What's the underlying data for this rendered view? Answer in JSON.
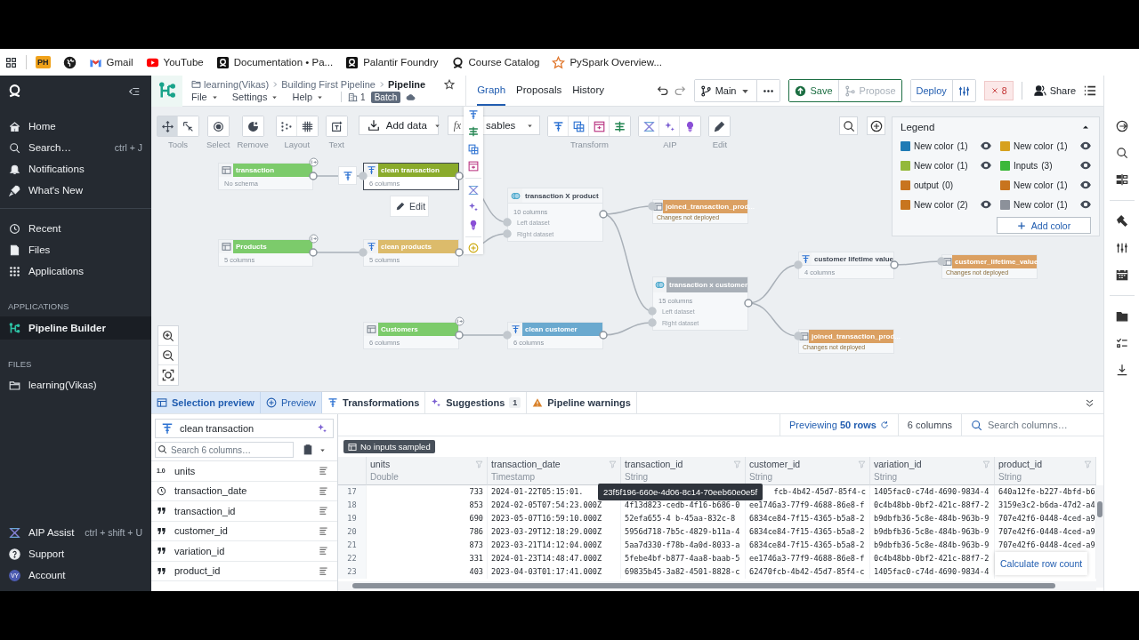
{
  "bookmarks": [
    {
      "kind": "tile",
      "tile": "PH"
    },
    {
      "kind": "globe"
    },
    {
      "kind": "gmail",
      "label": "Gmail"
    },
    {
      "kind": "youtube",
      "label": "YouTube"
    },
    {
      "kind": "palantir",
      "label": "Documentation • Pa..."
    },
    {
      "kind": "palantir",
      "label": "Palantir Foundry"
    },
    {
      "kind": "ring",
      "label": "Course Catalog"
    },
    {
      "kind": "star",
      "label": "PySpark Overview..."
    }
  ],
  "sidebar": {
    "top_items": [
      {
        "label": "Home"
      },
      {
        "label": "Search…",
        "shortcut": "ctrl + J"
      },
      {
        "label": "Notifications"
      },
      {
        "label": "What's New"
      }
    ],
    "mid_items": [
      {
        "label": "Recent"
      },
      {
        "label": "Files"
      },
      {
        "label": "Applications"
      }
    ],
    "applications_heading": "APPLICATIONS",
    "applications": [
      {
        "label": "Pipeline Builder",
        "selected": true
      }
    ],
    "files_heading": "FILES",
    "files": [
      {
        "label": "learning(Vikas)"
      }
    ],
    "bottom_items": [
      {
        "label": "AIP Assist",
        "shortcut": "ctrl + shift + U"
      },
      {
        "label": "Support"
      },
      {
        "label": "Account",
        "avatar": "VY"
      }
    ]
  },
  "header": {
    "breadcrumb": [
      "learning(Vikas)",
      "Building First Pipeline",
      "Pipeline"
    ],
    "menus": [
      "File",
      "Settings",
      "Help"
    ],
    "count": "1",
    "badge": "Batch",
    "tabs": [
      {
        "label": "Graph",
        "selected": true
      },
      {
        "label": "Proposals",
        "selected": false
      },
      {
        "label": "History",
        "selected": false
      }
    ],
    "branch": "Main",
    "save": "Save",
    "propose": {
      "label": "Propose",
      "disabled": true
    },
    "deploy": "Deploy",
    "errors": "8",
    "share": "Share"
  },
  "toolbar": {
    "groups": [
      {
        "kind": "icons",
        "label": "Tools",
        "buttons": [
          {
            "selected": true
          },
          {
            "selected": false
          }
        ]
      },
      {
        "kind": "icons",
        "label": "Select",
        "buttons": [
          {
            "selected": false
          }
        ]
      },
      {
        "kind": "icons",
        "label": "Remove",
        "buttons": [
          {
            "selected": false
          }
        ]
      },
      {
        "kind": "icons",
        "label": "Layout",
        "buttons": [
          {
            "selected": false
          },
          {
            "selected": false
          }
        ]
      },
      {
        "kind": "icons",
        "label": "Text",
        "buttons": [
          {
            "selected": false
          }
        ]
      },
      {
        "kind": "dropdown",
        "label": "Add data"
      },
      {
        "kind": "dropdown",
        "prefix": "fx",
        "label": "sables"
      },
      {
        "kind": "icons",
        "label": "Transform",
        "buttons": [
          {
            "selected": false
          },
          {
            "selected": false
          },
          {
            "selected": false
          },
          {
            "selected": false
          }
        ]
      },
      {
        "kind": "icons",
        "label": "AIP",
        "buttons": [
          {
            "selected": false
          },
          {
            "selected": false
          },
          {
            "selected": false
          }
        ]
      },
      {
        "kind": "icons",
        "label": "Edit",
        "buttons": [
          {
            "selected": false
          }
        ]
      }
    ]
  },
  "canvas": {
    "nodes": [
      {
        "kind": "dataset",
        "title": "transaction",
        "subtitle": "No schema",
        "color": "#7ccb6b",
        "selected": false,
        "input_marker": true
      },
      {
        "kind": "transform",
        "title": "clean transaction",
        "subtitle": "6 columns",
        "color": "#8aab2b",
        "selected": true,
        "input_marker": false
      },
      {
        "kind": "dataset",
        "title": "Products",
        "subtitle": "5 columns",
        "color": "#7ccb6b",
        "selected": false,
        "input_marker": true
      },
      {
        "kind": "transform",
        "title": "clean products",
        "subtitle": "5 columns",
        "color": "#dcbb6b",
        "selected": false,
        "input_marker": false
      },
      {
        "kind": "join",
        "title": "transaction X product",
        "subtitle": "10 columns",
        "color": "#f5f7f9",
        "selected": false,
        "input_marker": false,
        "inputs": [
          "Left dataset",
          "Right dataset"
        ]
      },
      {
        "kind": "output",
        "title": "joined_transaction_prod...",
        "note": "Changes not deployed",
        "color": "#dba062",
        "selected": false,
        "input_marker": false
      },
      {
        "kind": "dataset",
        "title": "Customers",
        "subtitle": "6 columns",
        "color": "#7ccb6b",
        "selected": false,
        "input_marker": true
      },
      {
        "kind": "transform",
        "title": "clean customer",
        "subtitle": "6 columns",
        "color": "#6aa9cf",
        "selected": false,
        "input_marker": false
      },
      {
        "kind": "join",
        "title": "transaction x customer",
        "subtitle": "15 columns",
        "color": "#a9b0b8",
        "selected": false,
        "input_marker": false,
        "inputs": [
          "Left dataset",
          "Right dataset"
        ]
      },
      {
        "kind": "transform",
        "title": "customer lifetime value",
        "subtitle": "4 columns",
        "color": "#f5f7f9",
        "selected": false,
        "input_marker": false
      },
      {
        "kind": "output",
        "title": "customer_lifetime_value",
        "note": "Changes not deployed",
        "color": "#dba062",
        "selected": false,
        "input_marker": false
      },
      {
        "kind": "output",
        "title": "joined_transaction_prod...",
        "note": "Changes not deployed",
        "color": "#dba062",
        "selected": false,
        "input_marker": false
      }
    ],
    "edit_button": "Edit",
    "legend": {
      "title": "Legend",
      "items": [
        {
          "label": "New color",
          "count": "(1)",
          "color": "#1f7bb5",
          "has_eye": true
        },
        {
          "label": "New color",
          "count": "(1)",
          "color": "#d6a11f",
          "has_eye": true
        },
        {
          "label": "New color",
          "count": "(1)",
          "color": "#93b93a",
          "has_eye": true
        },
        {
          "label": "Inputs",
          "count": "(3)",
          "color": "#3cb83a",
          "has_eye": true
        },
        {
          "label": "output",
          "count": "(0)",
          "color": "#c8741f",
          "has_eye": false
        },
        {
          "label": "New color",
          "count": "(1)",
          "color": "#c8741e",
          "has_eye": true
        },
        {
          "label": "New color",
          "count": "(2)",
          "color": "#c8751f",
          "has_eye": true
        },
        {
          "label": "New color",
          "count": "(1)",
          "color": "#8c919a",
          "has_eye": true
        }
      ],
      "add_button": "Add color"
    }
  },
  "bottom": {
    "tabs": [
      {
        "kind": "toggle",
        "label": "Selection preview",
        "selected": true
      },
      {
        "kind": "toggle",
        "label": "Preview",
        "selected": false
      },
      {
        "kind": "tab",
        "label": "Transformations",
        "selected": false
      },
      {
        "kind": "tab",
        "label": "Suggestions",
        "count": "1",
        "selected": false
      },
      {
        "kind": "tab",
        "label": "Pipeline warnings",
        "selected": false
      }
    ],
    "transform_panel": {
      "name": "clean transaction",
      "search_placeholder": "Search 6 columns…",
      "columns": [
        {
          "kind": "double",
          "glyph": "1.0",
          "name": "units"
        },
        {
          "kind": "timestamp",
          "name": "transaction_date"
        },
        {
          "kind": "string",
          "name": "transaction_id"
        },
        {
          "kind": "string",
          "name": "customer_id"
        },
        {
          "kind": "string",
          "name": "variation_id"
        },
        {
          "kind": "string",
          "name": "product_id"
        }
      ]
    },
    "table": {
      "previewing": "Previewing **50 rows**",
      "column_count": "6 columns",
      "search_placeholder": "Search columns…",
      "sample_badge": "No inputs sampled",
      "columns": [
        {
          "name": "units",
          "type": "Double"
        },
        {
          "name": "transaction_date",
          "type": "Timestamp"
        },
        {
          "name": "transaction_id",
          "type": "String"
        },
        {
          "name": "customer_id",
          "type": "String"
        },
        {
          "name": "variation_id",
          "type": "String"
        },
        {
          "name": "product_id",
          "type": "String"
        }
      ],
      "rows": [
        {
          "num": "17",
          "cells": [
            "733",
            "2024-01-22T05:15:01.",
            null,
            "fcb-4b42-45d7-85f4-c",
            "1405fac0-c74d-4690-9834-4",
            "640a12fe-b227-4bfd-b6"
          ]
        },
        {
          "num": "18",
          "cells": [
            "853",
            "2024-02-05T07:54:23.000Z",
            "4f13d823-cedb-4f16-b686-0",
            "ee1746a3-77f9-4688-86e8-f",
            "0c4b48bb-0bf2-421c-88f7-2",
            "3159e3c2-b6da-47d2-a4"
          ]
        },
        {
          "num": "19",
          "cells": [
            "690",
            "2023-05-07T16:59:10.000Z",
            "52efa655-4 b-45aa-832c-8",
            "6834ce84-7f15-4365-b5a8-2",
            "b9dbfb36-5c8e-484b-963b-9",
            "707e42f6-0448-4ced-a9"
          ]
        },
        {
          "num": "20",
          "cells": [
            "786",
            "2023-03-29T12:18:29.000Z",
            "5956d718-7b5c-4829-b11a-4",
            "6834ce84-7f15-4365-b5a8-2",
            "b9dbfb36-5c8e-484b-963b-9",
            "707e42f6-0448-4ced-a9"
          ]
        },
        {
          "num": "21",
          "cells": [
            "873",
            "2023-03-21T14:12:04.000Z",
            "5aa7d330-f78b-4a0d-8033-a",
            "6834ce84-7f15-4365-b5a8-2",
            "b9dbfb36-5c8e-484b-963b-9",
            "707e42f6-0448-4ced-a9"
          ]
        },
        {
          "num": "22",
          "cells": [
            "331",
            "2024-01-23T14:48:47.000Z",
            "5febe4bf-b877-4aa8-baab-5",
            "ee1746a3-77f9-4688-86e8-f",
            "0c4b48bb-0bf2-421c-88f7-2",
            null
          ]
        },
        {
          "num": "23",
          "cells": [
            "403",
            "2023-04-03T01:17:41.000Z",
            "69835b45-3a82-4501-8828-c",
            "62470fcb-4b42-45d7-85f4-c",
            "1405fac0-c74d-4690-9834-4",
            null
          ]
        }
      ],
      "tooltip": "23f5f196-660e-4d06-8c14-70eeb60e0e5f",
      "popup": "Calculate row count"
    }
  }
}
